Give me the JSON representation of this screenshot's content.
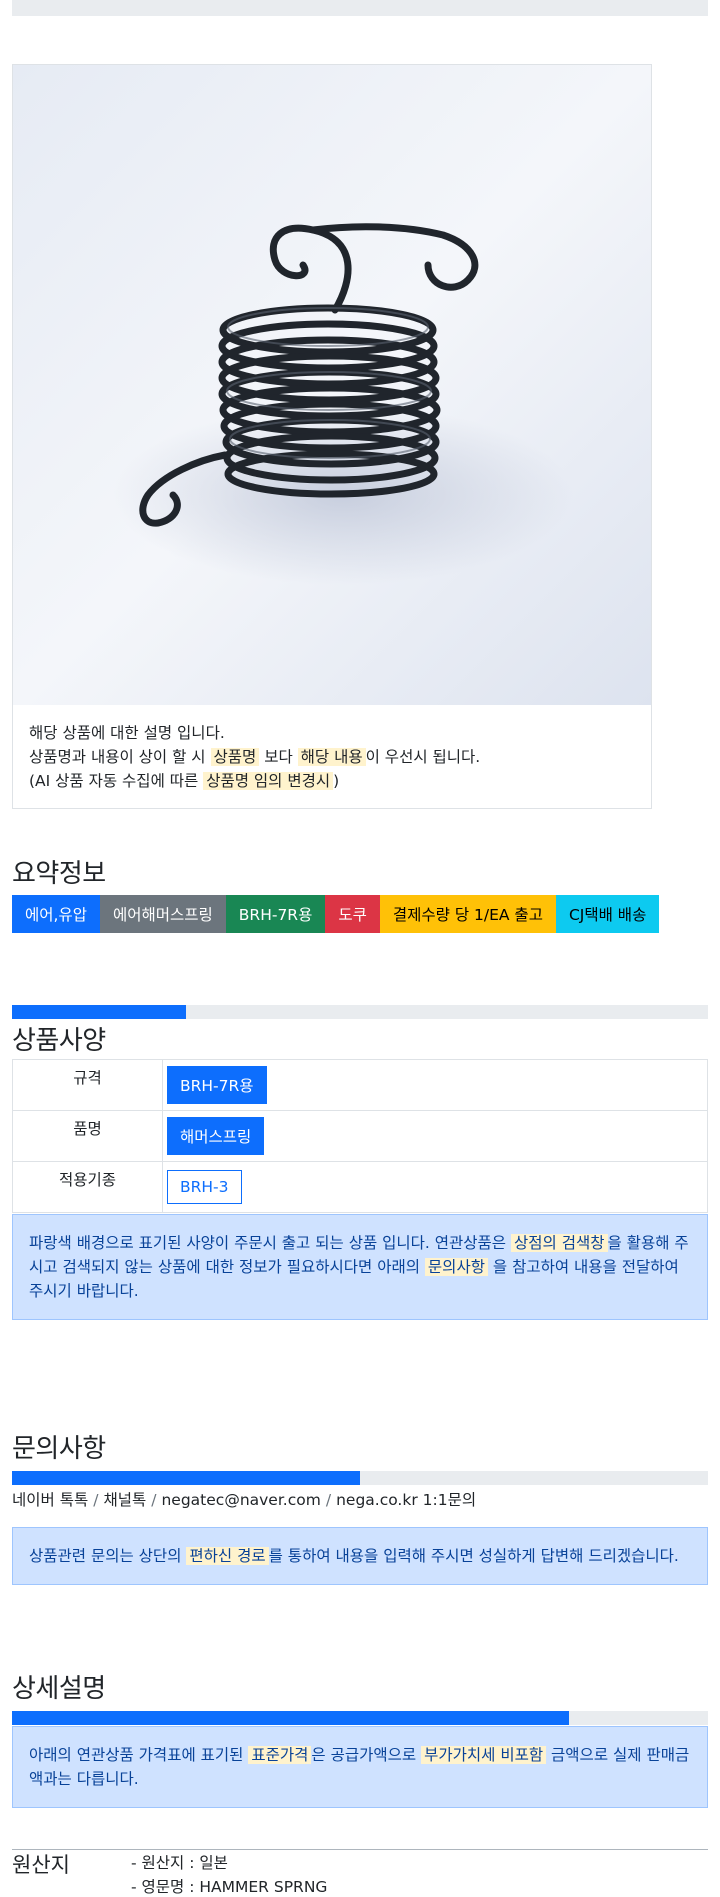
{
  "product": {
    "image_alt": "black torsion spring",
    "caption_line1": "해당 상품에 대한 설명 입니다.",
    "caption_line2_a": "상품명과 내용이 상이 할 시 ",
    "caption_line2_hl1": "상품명",
    "caption_line2_b": " 보다 ",
    "caption_line2_hl2": "해당 내용",
    "caption_line2_c": "이 우선시 됩니다.",
    "caption_line3_a": "(AI 상품 자동 수집에 따른 ",
    "caption_line3_hl": "상품명 임의 변경시",
    "caption_line3_b": ")"
  },
  "summary": {
    "title": "요약정보",
    "badges": [
      {
        "label": "에어,유압",
        "color": "#0d6efd",
        "text_color": "#ffffff"
      },
      {
        "label": "에어해머스프링",
        "color": "#6c757d",
        "text_color": "#ffffff"
      },
      {
        "label": "BRH-7R용",
        "color": "#198754",
        "text_color": "#ffffff"
      },
      {
        "label": "도쿠",
        "color": "#dc3545",
        "text_color": "#ffffff"
      },
      {
        "label": "결제수량 당 1/EA 출고",
        "color": "#ffc107",
        "text_color": "#000000"
      },
      {
        "label": "CJ택배 배송",
        "color": "#0dcaf0",
        "text_color": "#000000"
      }
    ]
  },
  "spec": {
    "title": "상품사양",
    "progress_fraction": 0.25,
    "rows": [
      {
        "key": "규격",
        "value": "BRH-7R용"
      },
      {
        "key": "품명",
        "value": "해머스프링"
      },
      {
        "key": "적용기종",
        "value": "BRH-3"
      }
    ],
    "notice_a": "파랑색 배경으로 표기된 사양이 주문시 출고 되는 상품 입니다. 연관상품은 ",
    "notice_hl1": "상점의 검색창",
    "notice_b": "을 활용해 주시고 검색되지 않는 상품에 대한 정보가 필요하시다면 아래의 ",
    "notice_hl2": "문의사항",
    "notice_c": " 을 참고하여 내용을 전달하여 주시기 바랍니다."
  },
  "inquiry": {
    "title": "문의사항",
    "progress_fraction": 0.5,
    "channels": [
      "네이버 톡톡",
      "채널톡",
      "negatec@naver.com",
      "nega.co.kr 1:1문의"
    ],
    "separator": "/",
    "notice_a": "상품관련 문의는 상단의 ",
    "notice_hl": "편하신 경로",
    "notice_b": "를 통하여 내용을 입력해 주시면 성실하게 답변해 드리겠습니다."
  },
  "detail": {
    "title": "상세설명",
    "progress_fraction": 0.8,
    "notice_a": "아래의 연관상품 가격표에 표기된 ",
    "notice_hl1": "표준가격",
    "notice_b": "은 공급가액으로 ",
    "notice_hl2": "부가가치세 비포함",
    "notice_c": " 금액으로 실제 판매금액과는 다릅니다."
  },
  "origin": {
    "label": "원산지",
    "items": [
      "- 원산지 : 일본",
      "- 영문명 : HAMMER SPRNG"
    ]
  }
}
